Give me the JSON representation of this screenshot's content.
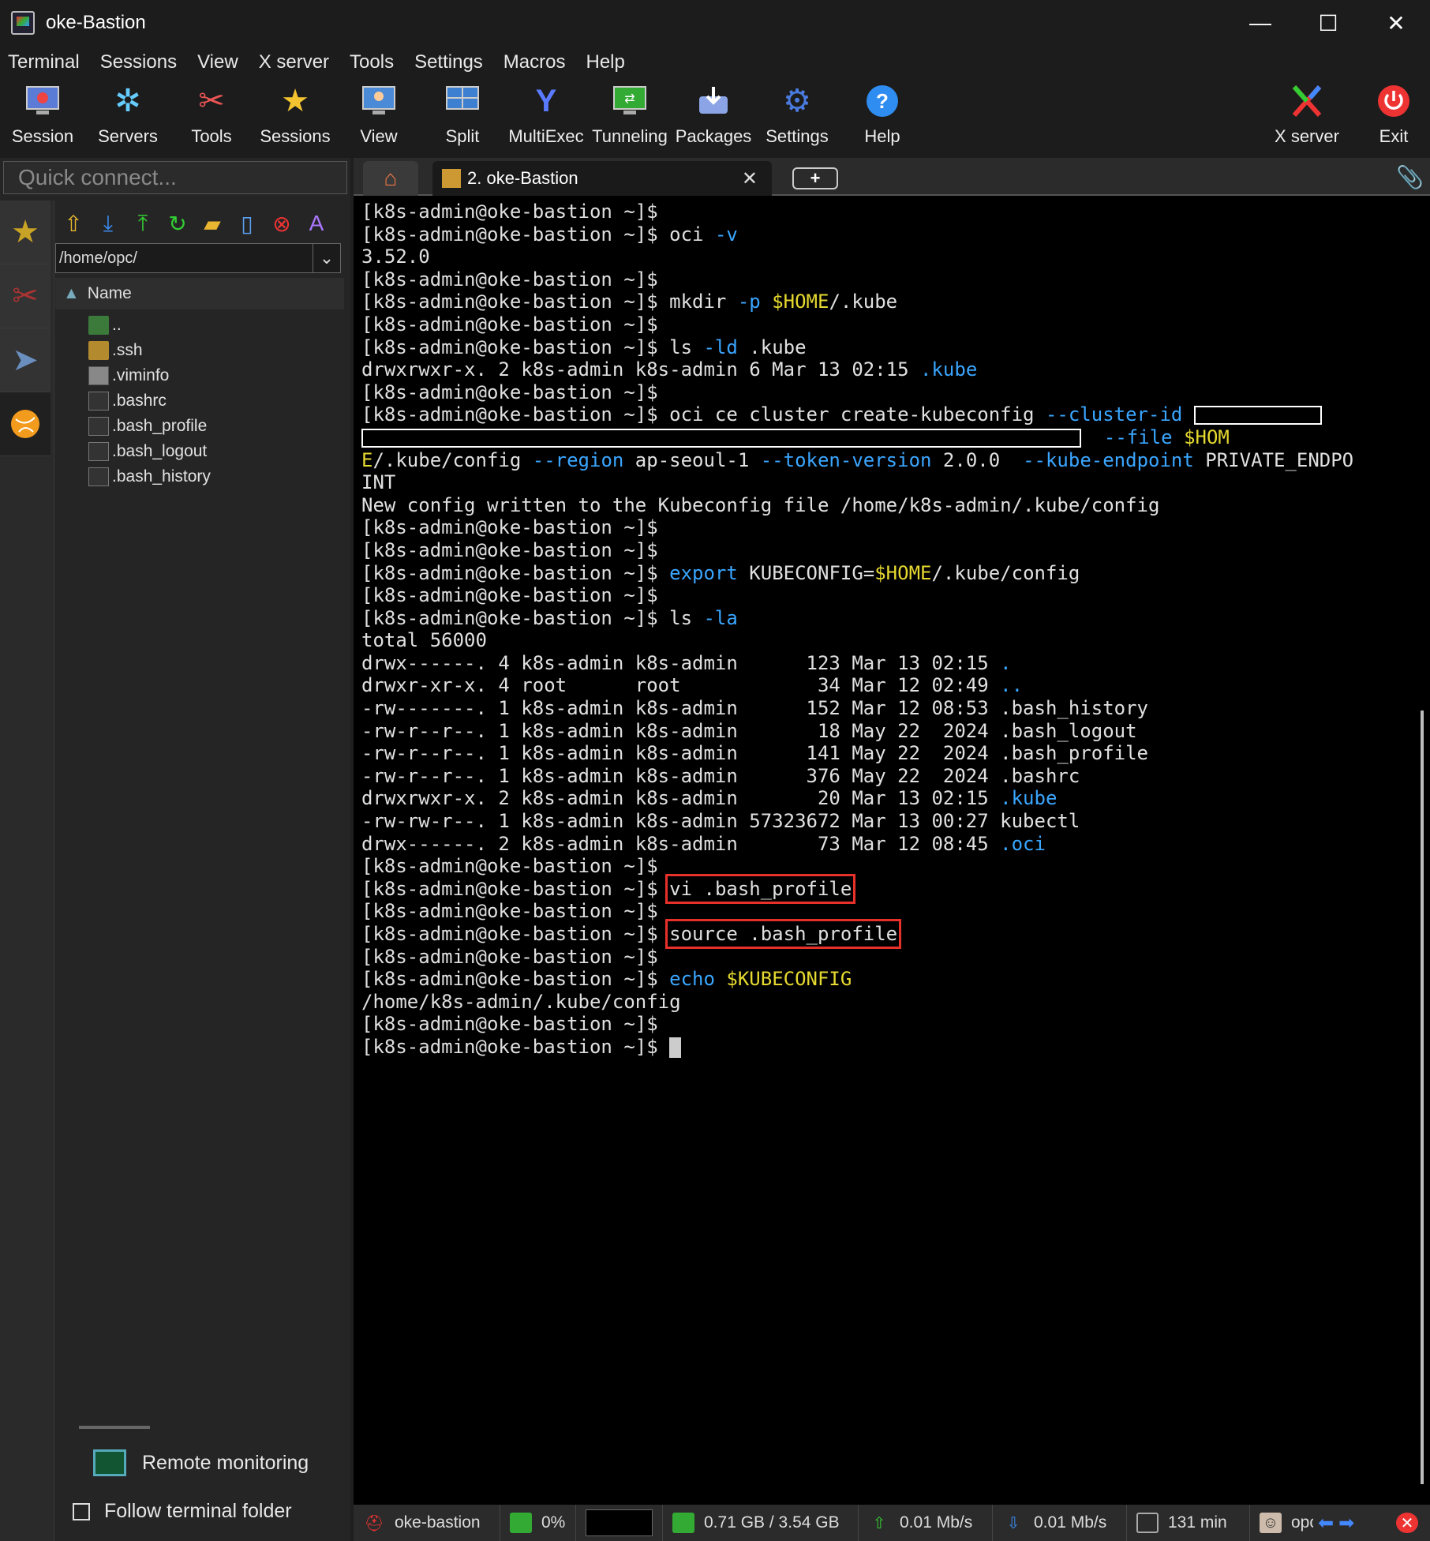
{
  "window": {
    "title": "oke-Bastion",
    "minimize": "—",
    "maximize": "☐",
    "close": "✕"
  },
  "menu": [
    "Terminal",
    "Sessions",
    "View",
    "X server",
    "Tools",
    "Settings",
    "Macros",
    "Help"
  ],
  "toolbar": {
    "session": "Session",
    "servers": "Servers",
    "tools": "Tools",
    "sessions": "Sessions",
    "view": "View",
    "split": "Split",
    "multiexec": "MultiExec",
    "tunneling": "Tunneling",
    "packages": "Packages",
    "settings": "Settings",
    "help": "Help",
    "xserver": "X server",
    "exit": "Exit"
  },
  "sidebar": {
    "quick_connect_placeholder": "Quick connect...",
    "path": "/home/opc/",
    "column": "Name",
    "files": [
      {
        "name": "..",
        "type": "up"
      },
      {
        "name": ".ssh",
        "type": "folder"
      },
      {
        "name": ".viminfo",
        "type": "doc"
      },
      {
        "name": ".bashrc",
        "type": "term"
      },
      {
        "name": ".bash_profile",
        "type": "term"
      },
      {
        "name": ".bash_logout",
        "type": "term"
      },
      {
        "name": ".bash_history",
        "type": "term"
      }
    ],
    "remote_monitoring": "Remote monitoring",
    "follow_terminal": "Follow terminal folder"
  },
  "tabs": {
    "session_tab": "2. oke-Bastion"
  },
  "terminal": {
    "prompt": "[k8s-admin@oke-bastion ~]$",
    "lines": [
      [
        {
          "t": "[k8s-admin@oke-bastion ~]$"
        }
      ],
      [
        {
          "t": "[k8s-admin@oke-bastion ~]$ oci "
        },
        {
          "t": "-v",
          "c": "blue"
        }
      ],
      [
        {
          "t": "3.52.0"
        }
      ],
      [
        {
          "t": "[k8s-admin@oke-bastion ~]$"
        }
      ],
      [
        {
          "t": "[k8s-admin@oke-bastion ~]$ mkdir "
        },
        {
          "t": "-p",
          "c": "blue"
        },
        {
          "t": " "
        },
        {
          "t": "$HOME",
          "c": "yellow"
        },
        {
          "t": "/.kube"
        }
      ],
      [
        {
          "t": "[k8s-admin@oke-bastion ~]$"
        }
      ],
      [
        {
          "t": "[k8s-admin@oke-bastion ~]$ ls "
        },
        {
          "t": "-ld",
          "c": "blue"
        },
        {
          "t": " .kube"
        }
      ],
      [
        {
          "t": "drwxrwxr-x. 2 k8s-admin k8s-admin 6 Mar 13 02:15 "
        },
        {
          "t": ".kube",
          "c": "blue"
        }
      ],
      [
        {
          "t": "[k8s-admin@oke-bastion ~]$"
        }
      ],
      [
        {
          "t": "[k8s-admin@oke-bastion ~]$ oci ce cluster create-kubeconfig "
        },
        {
          "t": "--cluster-id",
          "c": "blue"
        },
        {
          "t": " "
        },
        {
          "r": 162
        }
      ],
      [
        {
          "r": 912
        },
        {
          "t": "  "
        },
        {
          "t": "--file",
          "c": "blue"
        },
        {
          "t": " "
        },
        {
          "t": "$HOM",
          "c": "yellow"
        }
      ],
      [
        {
          "t": "E",
          "c": "yellow"
        },
        {
          "t": "/.kube/config "
        },
        {
          "t": "--region",
          "c": "blue"
        },
        {
          "t": " ap-seoul-1 "
        },
        {
          "t": "--token-version",
          "c": "blue"
        },
        {
          "t": " 2.0.0  "
        },
        {
          "t": "--kube-endpoint",
          "c": "blue"
        },
        {
          "t": " PRIVATE_ENDPO"
        }
      ],
      [
        {
          "t": "INT"
        }
      ],
      [
        {
          "t": "New config written to the Kubeconfig file /home/k8s-admin/.kube/config"
        }
      ],
      [
        {
          "t": "[k8s-admin@oke-bastion ~]$"
        }
      ],
      [
        {
          "t": "[k8s-admin@oke-bastion ~]$"
        }
      ],
      [
        {
          "t": "[k8s-admin@oke-bastion ~]$ "
        },
        {
          "t": "export",
          "c": "blue"
        },
        {
          "t": " KUBECONFIG="
        },
        {
          "t": "$HOME",
          "c": "yellow"
        },
        {
          "t": "/.kube/config"
        }
      ],
      [
        {
          "t": "[k8s-admin@oke-bastion ~]$"
        }
      ],
      [
        {
          "t": "[k8s-admin@oke-bastion ~]$ ls "
        },
        {
          "t": "-la",
          "c": "blue"
        }
      ],
      [
        {
          "t": "total 56000"
        }
      ],
      [
        {
          "t": "drwx------. 4 k8s-admin k8s-admin      123 Mar 13 02:15 "
        },
        {
          "t": ".",
          "c": "blue"
        }
      ],
      [
        {
          "t": "drwxr-xr-x. 4 root      root            34 Mar 12 02:49 "
        },
        {
          "t": "..",
          "c": "blue"
        }
      ],
      [
        {
          "t": "-rw-------. 1 k8s-admin k8s-admin      152 Mar 12 08:53 .bash_history"
        }
      ],
      [
        {
          "t": "-rw-r--r--. 1 k8s-admin k8s-admin       18 May 22  2024 .bash_logout"
        }
      ],
      [
        {
          "t": "-rw-r--r--. 1 k8s-admin k8s-admin      141 May 22  2024 .bash_profile"
        }
      ],
      [
        {
          "t": "-rw-r--r--. 1 k8s-admin k8s-admin      376 May 22  2024 .bashrc"
        }
      ],
      [
        {
          "t": "drwxrwxr-x. 2 k8s-admin k8s-admin       20 Mar 13 02:15 "
        },
        {
          "t": ".kube",
          "c": "blue"
        }
      ],
      [
        {
          "t": "-rw-rw-r--. 1 k8s-admin k8s-admin 57323672 Mar 13 00:27 kubectl"
        }
      ],
      [
        {
          "t": "drwx------. 2 k8s-admin k8s-admin       73 Mar 12 08:45 "
        },
        {
          "t": ".oci",
          "c": "blue"
        }
      ],
      [
        {
          "t": "[k8s-admin@oke-bastion ~]$"
        }
      ],
      [
        {
          "t": "[k8s-admin@oke-bastion ~]$ "
        },
        {
          "t": "vi .bash_profile",
          "h": 1
        }
      ],
      [
        {
          "t": "[k8s-admin@oke-bastion ~]$"
        }
      ],
      [
        {
          "t": "[k8s-admin@oke-bastion ~]$ "
        },
        {
          "t": "source .bash_profile",
          "h": 1
        }
      ],
      [
        {
          "t": "[k8s-admin@oke-bastion ~]$"
        }
      ],
      [
        {
          "t": "[k8s-admin@oke-bastion ~]$ "
        },
        {
          "t": "echo",
          "c": "blue"
        },
        {
          "t": " "
        },
        {
          "t": "$KUBECONFIG",
          "c": "yellow"
        }
      ],
      [
        {
          "t": "/home/k8s-admin/.kube/config"
        }
      ],
      [
        {
          "t": "[k8s-admin@oke-bastion ~]$"
        }
      ],
      [
        {
          "t": "[k8s-admin@oke-bastion ~]$ "
        },
        {
          "cur": 1
        }
      ]
    ]
  },
  "status": {
    "host": "oke-bastion",
    "cpu": "0%",
    "memory": "0.71 GB / 3.54 GB",
    "upload": "0.01 Mb/s",
    "download": "0.01 Mb/s",
    "uptime": "131 min",
    "user": "opc"
  },
  "colors": {
    "blue": "#3aa6ff",
    "yellow": "#e6d930",
    "highlight": "#e8302a"
  }
}
